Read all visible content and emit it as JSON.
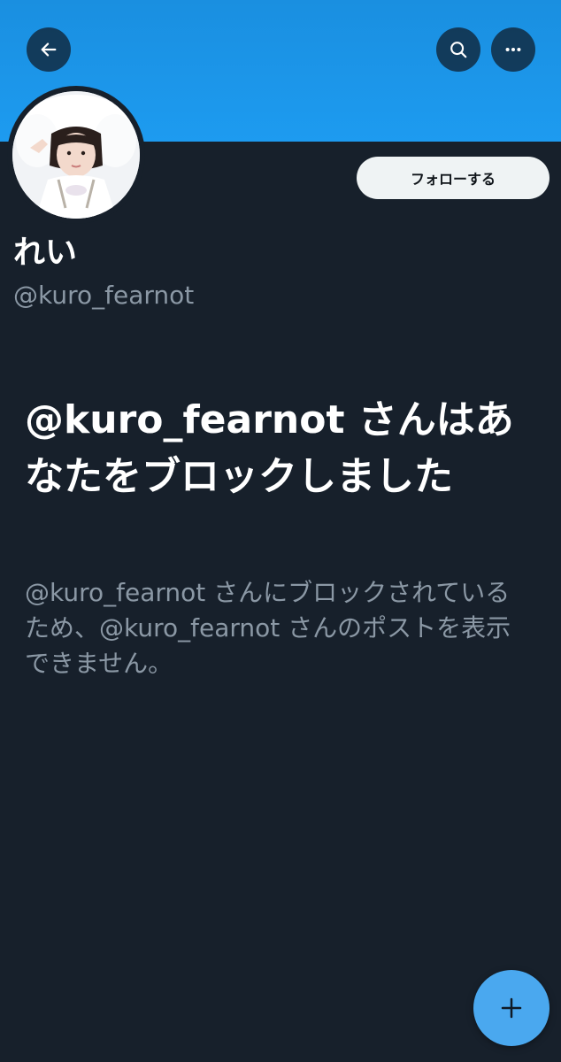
{
  "colors": {
    "banner": "#1d9bf0",
    "background": "#17202b",
    "primary_text": "#ffffff",
    "secondary_text": "#8b98a5",
    "fab": "#4aa8ef",
    "follow_button_bg": "#eff3f4"
  },
  "header": {
    "back_icon": "arrow-left-icon",
    "search_icon": "search-icon",
    "more_icon": "more-horizontal-icon"
  },
  "profile": {
    "display_name": "れい",
    "handle": "@kuro_fearnot",
    "follow_label": "フォローする"
  },
  "blocked_notice": {
    "title": "@kuro_fearnot さんはあなたをブロックしました",
    "description": "@kuro_fearnot さんにブロックされているため、@kuro_fearnot さんのポストを表示できません。"
  },
  "fab": {
    "icon": "plus-icon"
  }
}
